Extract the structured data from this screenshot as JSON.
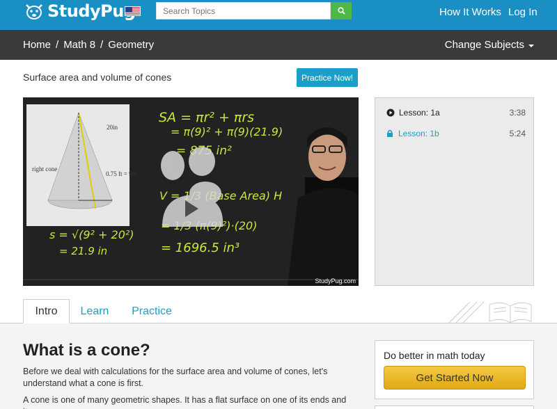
{
  "header": {
    "brand": "StudyPug",
    "search_placeholder": "Search Topics",
    "nav": [
      "How It Works",
      "Log In"
    ],
    "colors": {
      "header_bg": "#1a8fc4",
      "search_button": "#4db848"
    }
  },
  "breadcrumb": {
    "items": [
      "Home",
      "/",
      "Math 8",
      "/",
      "Geometry"
    ],
    "change_subjects": "Change Subjects"
  },
  "lesson": {
    "title": "Surface area and volume of cones",
    "practice_button": "Practice Now!"
  },
  "video": {
    "figure_labels": {
      "slant": "20in",
      "shape": "right cone",
      "radius": "0.75 ft = 9in",
      "s": "s"
    },
    "board_lines": [
      "SA = πr² + πrs",
      "= π(9)² + π(9)(21.9)",
      "= 875 in²",
      "V = 1/3 (Base Area) H",
      "= 1/3 (π(9)²)·(20)",
      "= 1696.5 in³",
      "s = √(9² + 20²)",
      "= 21.9 in"
    ],
    "watermark": "StudyPug.com"
  },
  "lessons": [
    {
      "label": "Lesson: 1a",
      "duration": "3:38",
      "icon": "play-icon"
    },
    {
      "label": "Lesson: 1b",
      "duration": "5:24",
      "icon": "lock-icon"
    }
  ],
  "tabs": [
    "Intro",
    "Learn",
    "Practice"
  ],
  "content": {
    "heading": "What is a cone?",
    "para1": "Before we deal with calculations for the surface area and volume of cones, let's understand what a cone is first.",
    "para2": "A cone is one of many geometric shapes. It has a flat surface on one of its ends and it"
  },
  "cta": {
    "title": "Do better in math today",
    "button": "Get Started Now"
  }
}
